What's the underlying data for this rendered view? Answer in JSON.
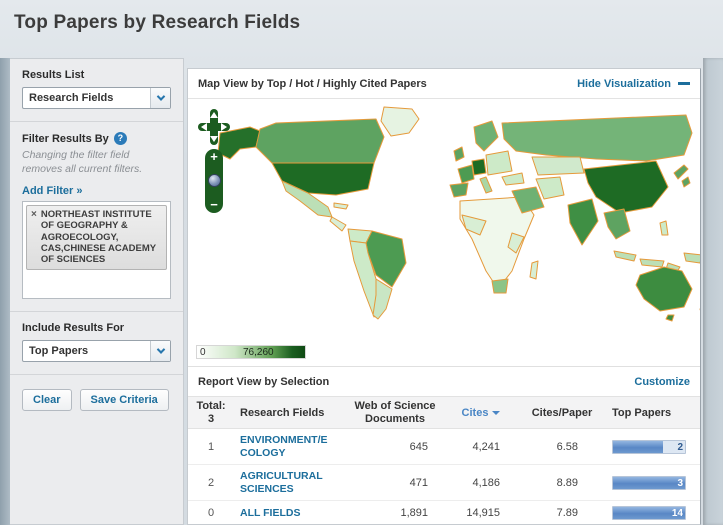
{
  "page": {
    "title": "Top Papers by Research Fields"
  },
  "icons": {
    "help": "?",
    "remove": "×",
    "zoom_in": "+",
    "zoom_out": "−"
  },
  "colors": {
    "link_blue": "#1c6e9c",
    "sort_blue": "#4a86c5",
    "bar_fill_blue": "#5b8fce",
    "map_border_orange": "#e59a3b",
    "map_dark_green": "#1e6b24",
    "legend_max_green": "#0f4a14"
  },
  "sidebar": {
    "results_list": {
      "label": "Results List",
      "selected": "Research Fields"
    },
    "filter": {
      "label": "Filter Results By",
      "note": "Changing the filter field removes all current filters.",
      "add_filter_label": "Add Filter »",
      "tags": [
        {
          "text": "NORTHEAST INSTITUTE OF GEOGRAPHY & AGROECOLOGY, CAS,CHINESE ACADEMY OF SCIENCES"
        }
      ]
    },
    "include_results_for": {
      "label": "Include Results For",
      "selected": "Top Papers"
    },
    "buttons": {
      "clear": "Clear",
      "save": "Save Criteria"
    }
  },
  "map_panel": {
    "title": "Map View by  Top / Hot / Highly Cited Papers",
    "hide_link": "Hide Visualization",
    "legend": {
      "min": "0",
      "max": "76,260"
    }
  },
  "report": {
    "title": "Report View by Selection",
    "customize_link": "Customize",
    "header": {
      "total_label": "Total:",
      "total_value": "3",
      "field": "Research Fields",
      "documents": "Web of Science Documents",
      "cites": "Cites",
      "cites_per_paper": "Cites/Paper",
      "top_papers": "Top Papers"
    },
    "rows": [
      {
        "rank": "1",
        "field": "ENVIRONMENT/ECOLOGY",
        "documents": "645",
        "cites": "4,241",
        "cites_per_paper": "6.58",
        "top_papers": "2",
        "bar_pct": 70
      },
      {
        "rank": "2",
        "field": "AGRICULTURAL SCIENCES",
        "documents": "471",
        "cites": "4,186",
        "cites_per_paper": "8.89",
        "top_papers": "3",
        "bar_pct": 100
      },
      {
        "rank": "0",
        "field": "ALL FIELDS",
        "documents": "1,891",
        "cites": "14,915",
        "cites_per_paper": "7.89",
        "top_papers": "14",
        "bar_pct": 100
      }
    ]
  }
}
